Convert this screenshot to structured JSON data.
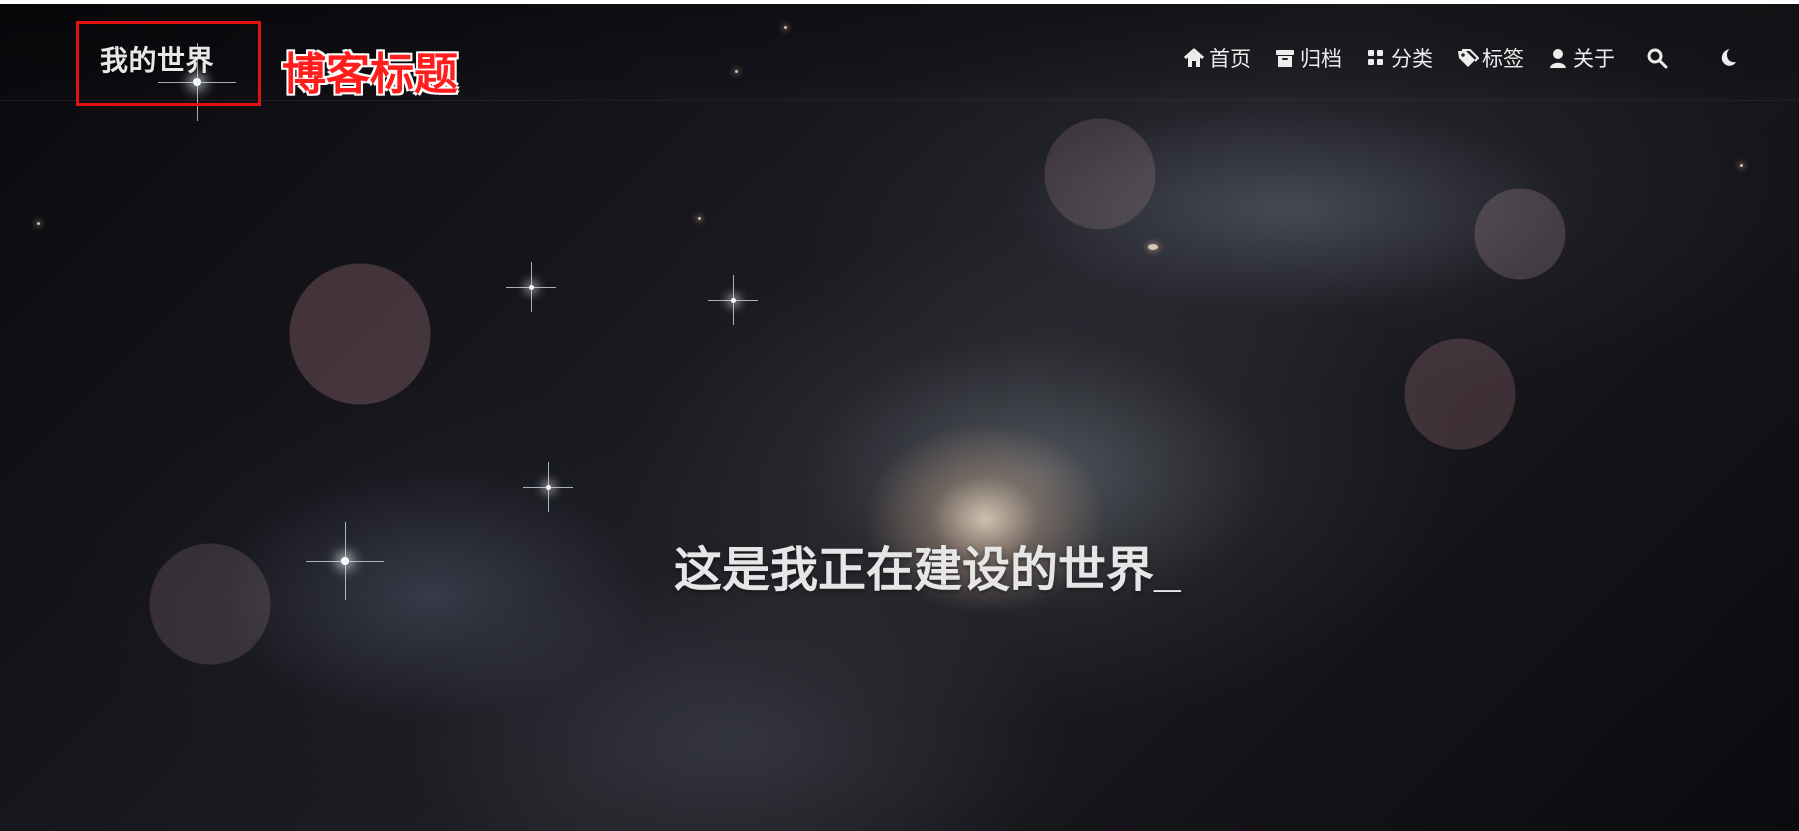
{
  "header": {
    "blog_title": "我的世界",
    "annotation_label": "博客标题",
    "annotation_color": "#ff1d1d",
    "annotation_box_color": "#e01212"
  },
  "nav": {
    "items": [
      {
        "label": "首页",
        "icon": "home-icon"
      },
      {
        "label": "归档",
        "icon": "archive-icon"
      },
      {
        "label": "分类",
        "icon": "category-icon"
      },
      {
        "label": "标签",
        "icon": "tag-icon"
      },
      {
        "label": "关于",
        "icon": "user-icon"
      }
    ],
    "search_icon": "search-icon",
    "theme_icon": "moon-icon"
  },
  "hero": {
    "text": "这是我正在建设的世界_",
    "background": "galaxy"
  },
  "colors": {
    "text": "#ededed",
    "hero_text": "#e6e6e6",
    "background": "#15151b"
  }
}
